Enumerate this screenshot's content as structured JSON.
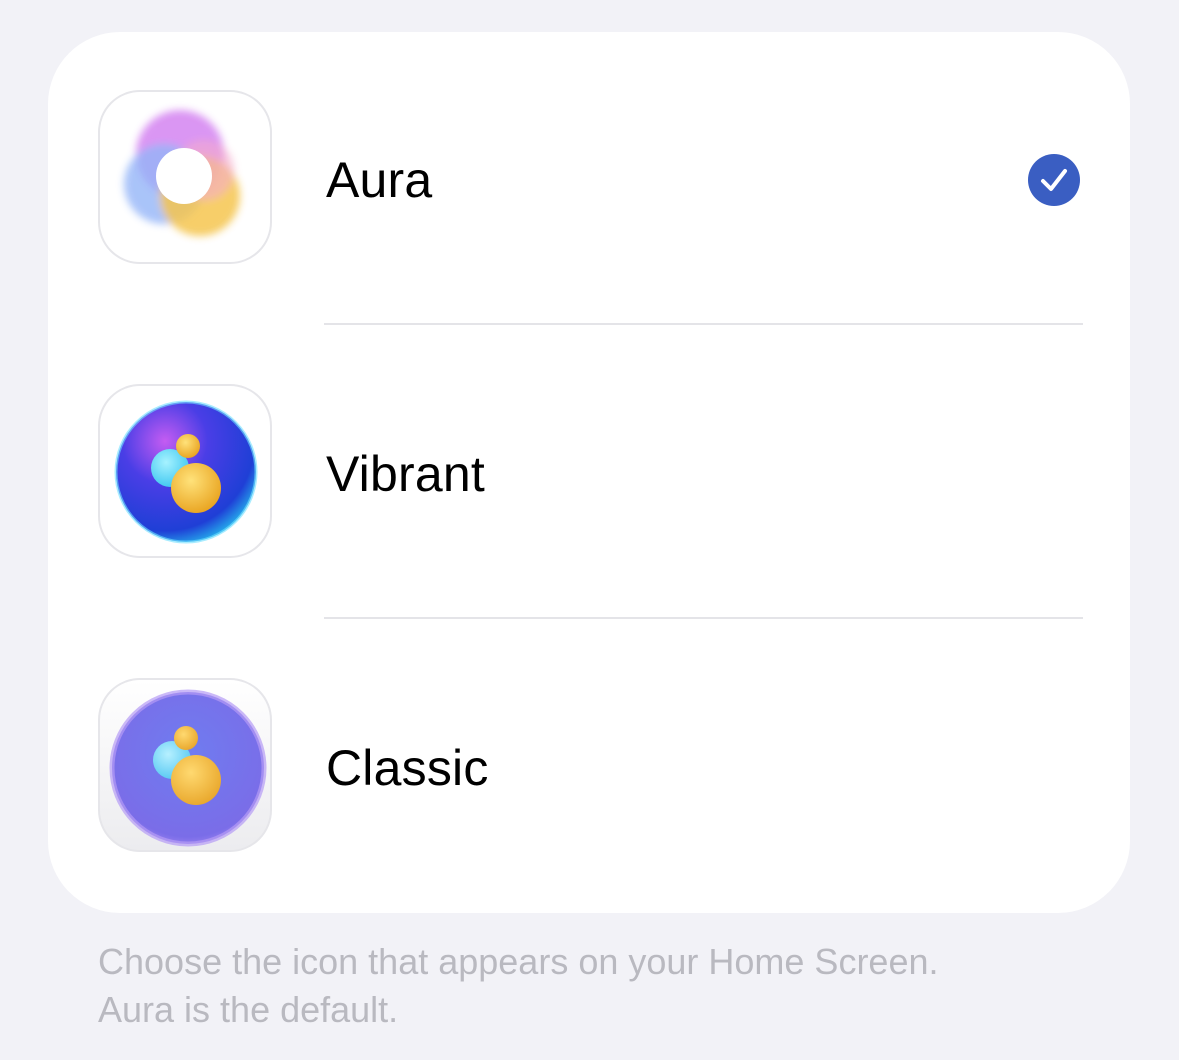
{
  "icon_options": [
    {
      "label": "Aura",
      "icon": "aura-icon",
      "selected": true
    },
    {
      "label": "Vibrant",
      "icon": "vibrant-icon",
      "selected": false
    },
    {
      "label": "Classic",
      "icon": "classic-icon",
      "selected": false
    }
  ],
  "selected_check_icon": "checkmark-icon",
  "footnote": {
    "line1": "Choose the icon that appears on your Home Screen.",
    "line2": "Aura is the default."
  },
  "colors": {
    "background": "#f2f2f7",
    "card": "#ffffff",
    "accent": "#3a5ec2",
    "footnote_text": "#b9b9c0"
  }
}
